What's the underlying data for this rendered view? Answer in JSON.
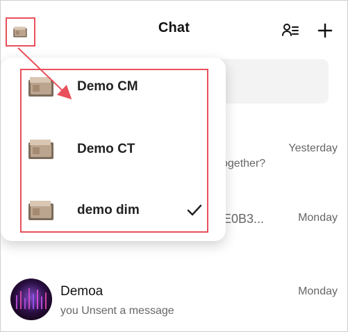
{
  "header": {
    "title": "Chat",
    "left_avatar_icon": "device-avatar-icon",
    "contacts_icon": "contacts-list-icon",
    "add_icon": "plus-icon"
  },
  "popup": {
    "items": [
      {
        "label": "Demo CM",
        "icon": "device-avatar-icon",
        "selected": false
      },
      {
        "label": "Demo CT",
        "icon": "device-avatar-icon",
        "selected": false
      },
      {
        "label": "demo dim",
        "icon": "device-avatar-icon",
        "selected": true
      }
    ],
    "check_icon": "checkmark-icon"
  },
  "chats": [
    {
      "time": "Yesterday",
      "preview": "ogether?"
    },
    {
      "preview": "E0B3...",
      "time": "Monday"
    },
    {
      "name": "Demoa",
      "preview": "you Unsent a message",
      "time": "Monday"
    }
  ],
  "colors": {
    "annotation": "#e8505b",
    "background": "#ffffff",
    "text": "#111111",
    "muted": "#666666"
  }
}
